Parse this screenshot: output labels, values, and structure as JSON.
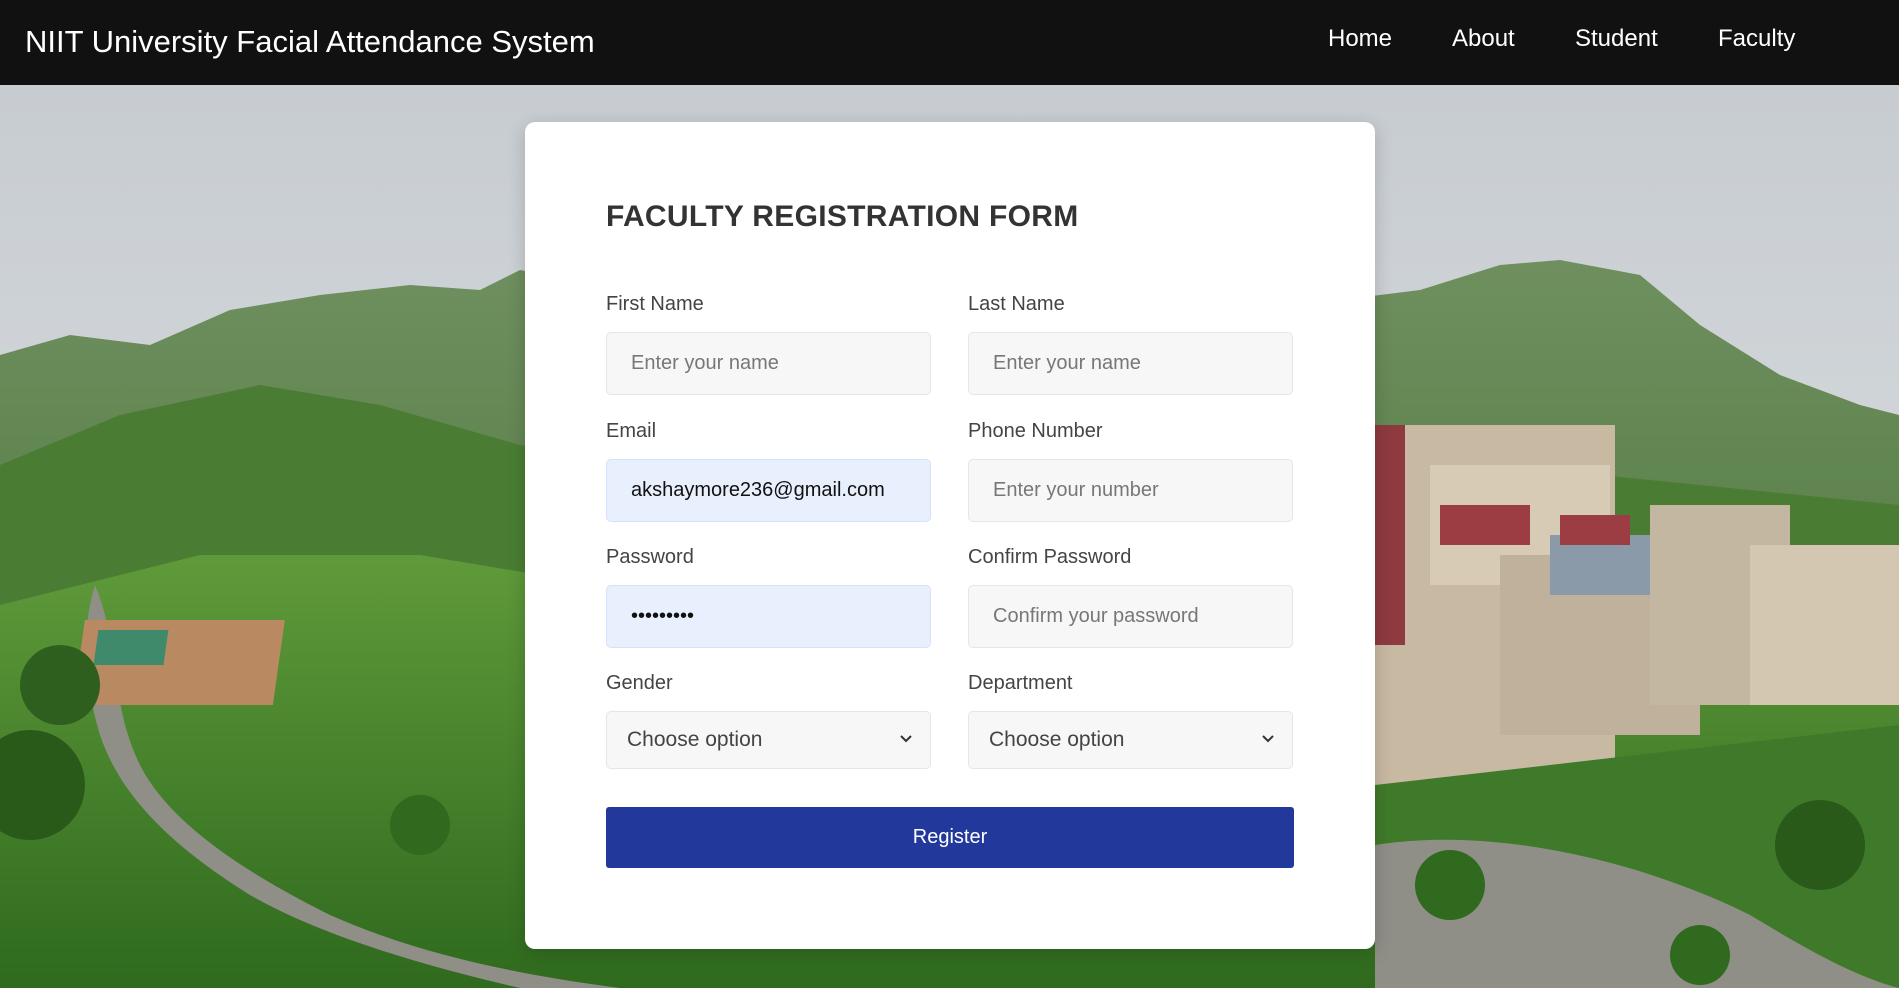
{
  "header": {
    "title": "NIIT University Facial Attendance System",
    "nav": [
      "Home",
      "About",
      "Student",
      "Faculty"
    ]
  },
  "form": {
    "title": "FACULTY REGISTRATION FORM",
    "first_name": {
      "label": "First Name",
      "placeholder": "Enter your name",
      "value": ""
    },
    "last_name": {
      "label": "Last Name",
      "placeholder": "Enter your name",
      "value": ""
    },
    "email": {
      "label": "Email",
      "placeholder": "",
      "value": "akshaymore236@gmail.com"
    },
    "phone": {
      "label": "Phone Number",
      "placeholder": "Enter your number",
      "value": ""
    },
    "password": {
      "label": "Password",
      "placeholder": "",
      "value": "•••••••••"
    },
    "confirm_password": {
      "label": "Confirm Password",
      "placeholder": "Confirm your password",
      "value": ""
    },
    "gender": {
      "label": "Gender",
      "selected": "Choose option"
    },
    "department": {
      "label": "Department",
      "selected": "Choose option"
    },
    "submit_label": "Register"
  },
  "colors": {
    "navbar": "#111111",
    "button": "#22399b",
    "autofill": "#e8f0fe",
    "input_bg": "#f7f7f7"
  },
  "icons": {
    "background": "campus-landscape-image",
    "select": "chevron-down-icon"
  }
}
